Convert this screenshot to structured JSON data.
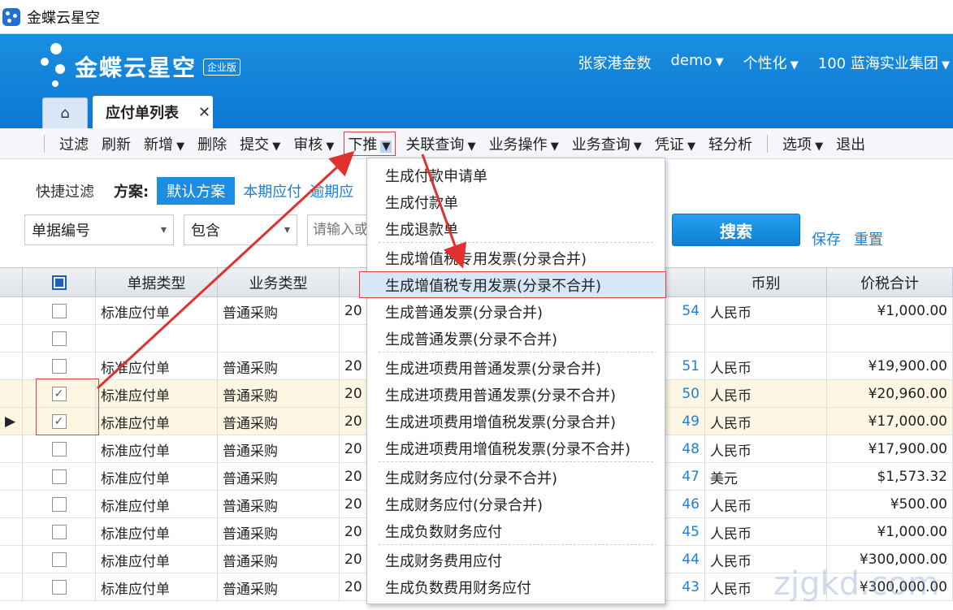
{
  "window": {
    "title": "金蝶云星空"
  },
  "header": {
    "logo_text": "金蝶云星空",
    "logo_badge": "企业版",
    "right_items": [
      "张家港金数",
      "demo",
      "个性化",
      "100  蓝海实业集团"
    ]
  },
  "tabs": {
    "home": "⌂",
    "active": "应付单列表",
    "close": "✕"
  },
  "toolbar": {
    "filter": "过滤",
    "refresh": "刷新",
    "add": "新增",
    "delete": "删除",
    "submit": "提交",
    "audit": "审核",
    "push": "下推",
    "linked_query": "关联查询",
    "biz_op": "业务操作",
    "biz_query": "业务查询",
    "voucher": "凭证",
    "analysis": "轻分析",
    "options": "选项",
    "exit": "退出"
  },
  "quick_filter": {
    "label": "快捷过滤",
    "scheme_label": "方案:",
    "schemes": [
      "默认方案",
      "本期应付",
      "逾期应"
    ]
  },
  "filter": {
    "field": "单据编号",
    "operator": "包含",
    "placeholder": "请输入或",
    "search": "搜索",
    "save": "保存",
    "reset": "重置"
  },
  "grid": {
    "columns": [
      "单据类型",
      "业务类型",
      "币别",
      "价税合计"
    ],
    "rows": [
      {
        "checked": false,
        "type": "标准应付单",
        "biz": "普通采购",
        "date": "20",
        "no": "54",
        "currency": "人民币",
        "amount": "¥1,000.00"
      },
      {
        "checked": false,
        "type": "",
        "biz": "",
        "date": "",
        "no": "",
        "currency": "",
        "amount": ""
      },
      {
        "checked": false,
        "type": "标准应付单",
        "biz": "普通采购",
        "date": "20",
        "no": "51",
        "currency": "人民币",
        "amount": "¥19,900.00"
      },
      {
        "checked": true,
        "type": "标准应付单",
        "biz": "普通采购",
        "date": "20",
        "no": "50",
        "currency": "人民币",
        "amount": "¥20,960.00"
      },
      {
        "checked": true,
        "type": "标准应付单",
        "biz": "普通采购",
        "date": "20",
        "no": "49",
        "currency": "人民币",
        "amount": "¥17,000.00"
      },
      {
        "checked": false,
        "type": "标准应付单",
        "biz": "普通采购",
        "date": "20",
        "no": "48",
        "currency": "人民币",
        "amount": "¥17,900.00"
      },
      {
        "checked": false,
        "type": "标准应付单",
        "biz": "普通采购",
        "date": "20",
        "no": "47",
        "currency": "美元",
        "amount": "$1,573.32"
      },
      {
        "checked": false,
        "type": "标准应付单",
        "biz": "普通采购",
        "date": "20",
        "no": "46",
        "currency": "人民币",
        "amount": "¥500.00"
      },
      {
        "checked": false,
        "type": "标准应付单",
        "biz": "普通采购",
        "date": "20",
        "no": "45",
        "currency": "人民币",
        "amount": "¥1,000.00"
      },
      {
        "checked": false,
        "type": "标准应付单",
        "biz": "普通采购",
        "date": "20",
        "no": "44",
        "currency": "人民币",
        "amount": "¥300,000.00"
      },
      {
        "checked": false,
        "type": "标准应付单",
        "biz": "普通采购",
        "date": "20",
        "no": "43",
        "currency": "人民币",
        "amount": "¥300,000.00"
      }
    ]
  },
  "push_menu": {
    "groups": [
      [
        "生成付款申请单",
        "生成付款单",
        "生成退款单"
      ],
      [
        "生成增值税专用发票(分录合并)",
        "生成增值税专用发票(分录不合并)",
        "生成普通发票(分录合并)",
        "生成普通发票(分录不合并)"
      ],
      [
        "生成进项费用普通发票(分录合并)",
        "生成进项费用普通发票(分录不合并)",
        "生成进项费用增值税发票(分录合并)",
        "生成进项费用增值税发票(分录不合并)"
      ],
      [
        "生成财务应付(分录不合并)",
        "生成财务应付(分录合并)",
        "生成负数财务应付"
      ],
      [
        "生成财务费用应付",
        "生成负数费用财务应付"
      ]
    ],
    "highlighted": "生成增值税专用发票(分录不合并)"
  },
  "watermark": "zjgkd.com"
}
